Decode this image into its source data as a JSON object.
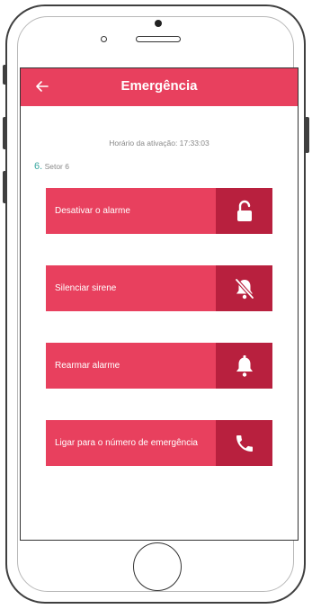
{
  "app_bar": {
    "title": "Emergência",
    "back_icon": "arrow-left-icon",
    "color": "#e8405e"
  },
  "activation_text": "Horário da ativação: 17:33:03",
  "sector": {
    "number": "6.",
    "name": "Setor 6",
    "number_color": "#3aa7a0"
  },
  "actions": [
    {
      "label": "Desativar o alarme",
      "icon": "unlock-icon"
    },
    {
      "label": "Silenciar sirene",
      "icon": "bell-off-icon"
    },
    {
      "label": "Rearmar alarme",
      "icon": "bell-icon"
    },
    {
      "label": "Ligar para o número de emergência",
      "icon": "phone-icon"
    }
  ],
  "colors": {
    "button": "#e8405e",
    "icon_box": "#b8203e"
  }
}
